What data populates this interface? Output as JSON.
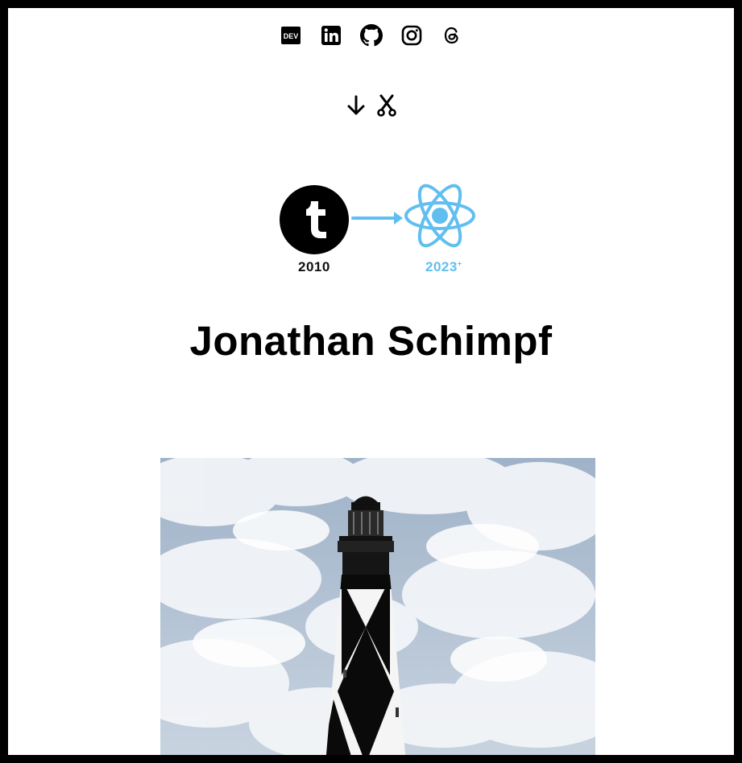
{
  "social": [
    {
      "name": "dev-link",
      "icon": "dev-icon"
    },
    {
      "name": "linkedin-link",
      "icon": "linkedin-icon"
    },
    {
      "name": "github-link",
      "icon": "github-icon"
    },
    {
      "name": "instagram-link",
      "icon": "instagram-icon"
    },
    {
      "name": "threads-link",
      "icon": "threads-icon"
    }
  ],
  "nav_icons": [
    "arrow-down-icon",
    "scissors-icon"
  ],
  "evolution": {
    "from_year": "2010",
    "from_icon": "tumblr-icon",
    "to_year": "2023",
    "to_suffix": "+",
    "to_icon": "react-icon",
    "accent": "#61bff0"
  },
  "heading": "Jonathan Schimpf",
  "hero_photo": {
    "subject": "lighthouse-photo"
  }
}
